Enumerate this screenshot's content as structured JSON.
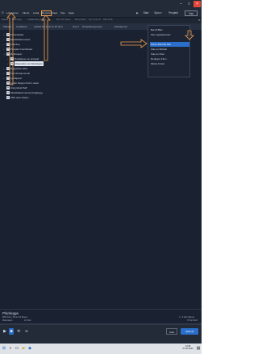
{
  "menu": {
    "items": [
      "Lokasjoner",
      "Fileret",
      "Lokal",
      "Remote",
      "Clear",
      "Vise",
      "Hjelp"
    ],
    "active_index": 3
  },
  "top_buttons": {
    "start": "Start",
    "sync": "Sync ▾",
    "project": "Prosjekt",
    "view": "Vise"
  },
  "pathbar": {
    "crumbs": [
      "Plakater",
      "Lokal Lager",
      "Lokalfiler/Meny Lokale",
      "FIF | 0 R | Nuster",
      "Beste Smiths",
      "Kol 2 | Lok 1 S",
      "Dahl 12 Vik"
    ]
  },
  "breadcrumb": {
    "crumbs": [
      "Plakater",
      "Lokalkarter",
      "LAKES 50 | LGG 8 | 36 Vik A",
      "Soul 1",
      "Rosteldata tjenester",
      "Rektrasjoner"
    ]
  },
  "tree": [
    {
      "label": "Produktdata",
      "collapsed": true
    },
    {
      "label": "Modelldokumenter",
      "collapsed": true
    },
    {
      "label": "Avdeling",
      "collapsed": true
    },
    {
      "label": "Prosjekt Coordinator",
      "collapsed": true
    },
    {
      "label": "Rektrasjon",
      "collapsed": false
    },
    {
      "label": "Rahaljosee av prosjekt",
      "collapsed": true,
      "child": true
    },
    {
      "label": "Disposition av Rektrasjon",
      "selected": true,
      "child": true
    },
    {
      "label": "Byggefase aktiv",
      "collapsed": true
    },
    {
      "label": "Koordinasjonsmal",
      "collapsed": true
    },
    {
      "label": "Lydrapport",
      "collapsed": true
    },
    {
      "label": "Lydler Rapport Del 1 avtal",
      "collapsed": false,
      "file": true
    },
    {
      "label": "Utstyrsbolt Paff",
      "file": true
    },
    {
      "label": "Modelldokumentvis-boligbygg",
      "file": true
    },
    {
      "label": "PRS arkiv Status",
      "file": true
    }
  ],
  "dropdown": {
    "items": [
      "Bar-fil Bilet",
      "Piler tagSpilviewer",
      "Serve Remote File",
      "Fale av Bokbat",
      "Fale av Filen",
      "Redigere Filen",
      "Mistra Kortet"
    ],
    "highlighted_index": 2
  },
  "info": {
    "title": "Planlegge",
    "subtitle": "88% Filer | 89 av 94 Skane",
    "meta_left": "Rektrasjon",
    "meta_mid": "21 Filer",
    "right_line1": "1 / 4 kb/s Allevat",
    "right_line2": "07.02.2022"
  },
  "player": {
    "progress": 0.0,
    "list_label": "Liste",
    "play_label": "Spill nå"
  },
  "taskbar": {
    "time": "13:08",
    "date": "07.02.2022"
  },
  "colors": {
    "accent": "#2a6fcc",
    "annotation": "#f0a050",
    "background": "#1a2130"
  }
}
